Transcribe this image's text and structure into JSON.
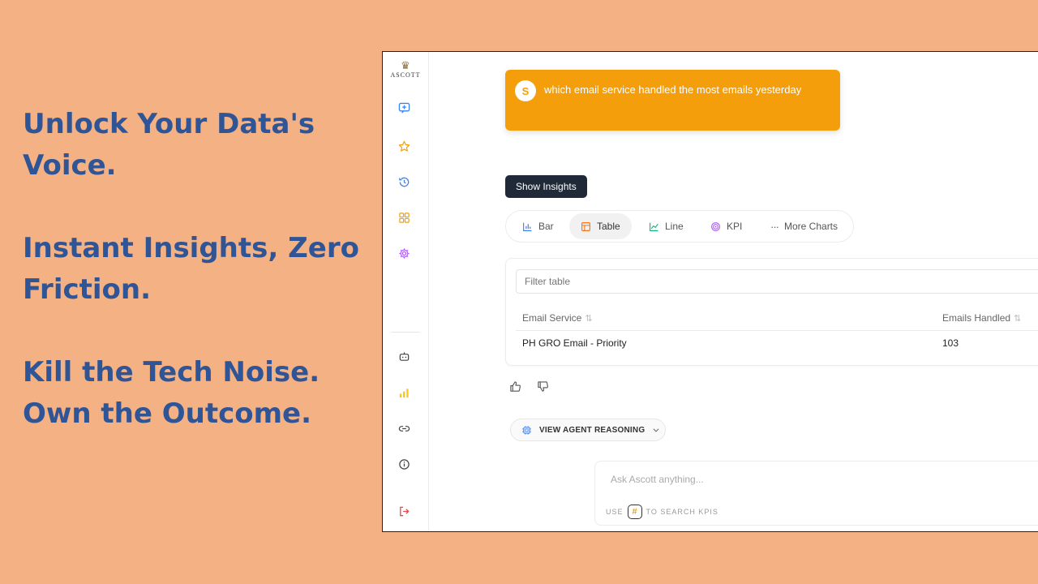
{
  "slogans": [
    "Unlock Your Data's Voice.",
    "Instant Insights, Zero Friction.",
    "Kill the Tech Noise. Own the Outcome."
  ],
  "app": {
    "logo_text": "ASCOTT",
    "sidebar": {
      "icons": [
        "new-chat-icon",
        "star-icon",
        "history-icon",
        "dashboard-icon",
        "settings-icon",
        "bot-icon",
        "bar-chart-icon",
        "link-icon",
        "info-icon",
        "logout-icon"
      ]
    },
    "user_message": {
      "avatar_initial": "S",
      "text": "which email service handled the most emails yesterday"
    },
    "show_insights_label": "Show Insights",
    "chart_tabs": [
      {
        "label": "Bar",
        "active": false
      },
      {
        "label": "Table",
        "active": true
      },
      {
        "label": "Line",
        "active": false
      },
      {
        "label": "KPI",
        "active": false
      },
      {
        "label": "More Charts",
        "active": false
      }
    ],
    "table": {
      "filter_placeholder": "Filter table",
      "columns": [
        "Email Service",
        "Emails Handled"
      ],
      "rows": [
        [
          "PH GRO Email - Priority",
          "103"
        ]
      ]
    },
    "reasoning_label": "VIEW AGENT REASONING",
    "ask": {
      "placeholder": "Ask Ascott anything...",
      "hint_prefix": "USE",
      "hint_symbol": "#",
      "hint_suffix": "TO SEARCH KPIS"
    },
    "colors": {
      "accent_orange": "#F59E0B",
      "dark_button": "#1f2937",
      "slogan_blue": "#2F5597",
      "background": "#F4B183"
    }
  }
}
